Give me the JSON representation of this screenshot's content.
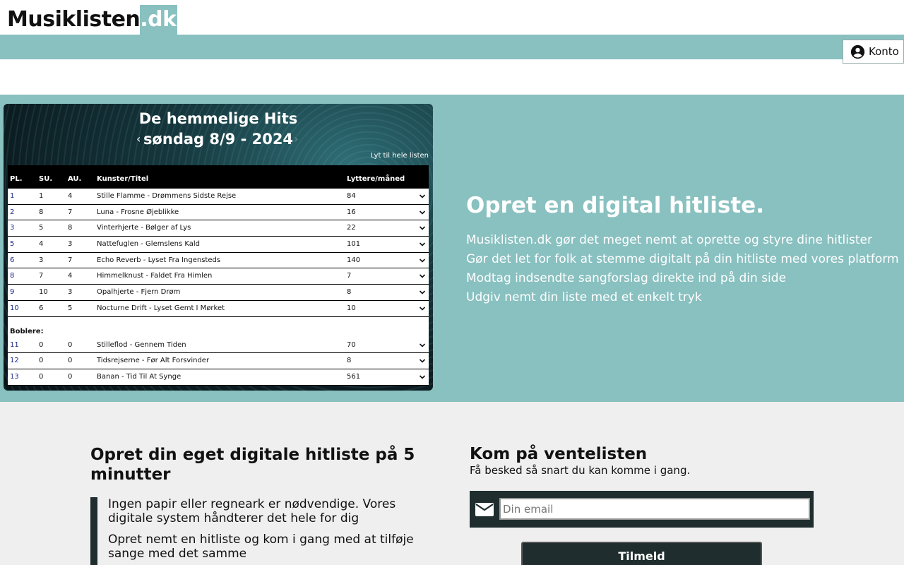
{
  "header": {
    "logo_main": "Musiklisten",
    "logo_tld": ".dk",
    "account_label": "Konto"
  },
  "chart": {
    "title": "De hemmelige Hits",
    "date": "søndag 8/9 - 2024",
    "listen_link": "Lyt til hele listen",
    "columns": {
      "pl": "PL.",
      "su": "SU.",
      "au": "AU.",
      "title": "Kunster/Titel",
      "listeners": "Lyttere/måned"
    },
    "rows": [
      {
        "pl": "1",
        "su": "1",
        "au": "4",
        "title": "Stille Flamme - Drømmens Sidste Rejse",
        "listeners": "84"
      },
      {
        "pl": "2",
        "su": "8",
        "au": "7",
        "title": "Luna - Frosne Øjeblikke",
        "listeners": "16"
      },
      {
        "pl": "3",
        "su": "5",
        "au": "8",
        "title": "Vinterhjerte - Bølger af Lys",
        "listeners": "22"
      },
      {
        "pl": "5",
        "su": "4",
        "au": "3",
        "title": "Nattefuglen - Glemslens Kald",
        "listeners": "101"
      },
      {
        "pl": "6",
        "su": "3",
        "au": "7",
        "title": "Echo Reverb - Lyset Fra Ingensteds",
        "listeners": "140"
      },
      {
        "pl": "8",
        "su": "7",
        "au": "4",
        "title": "Himmelknust - Faldet Fra Himlen",
        "listeners": "7"
      },
      {
        "pl": "9",
        "su": "10",
        "au": "3",
        "title": "Opalhjerte - Fjern Drøm",
        "listeners": "8"
      },
      {
        "pl": "10",
        "su": "6",
        "au": "5",
        "title": "Nocturne Drift - Lyset Gemt I Mørket",
        "listeners": "10"
      }
    ],
    "boblere_label": "Boblere:",
    "boblere": [
      {
        "pl": "11",
        "su": "0",
        "au": "0",
        "title": "Stilleflod - Gennem Tiden",
        "listeners": "70"
      },
      {
        "pl": "12",
        "su": "0",
        "au": "0",
        "title": "Tidsrejserne - Før Alt Forsvinder",
        "listeners": "8"
      },
      {
        "pl": "13",
        "su": "0",
        "au": "0",
        "title": "Banan - Tid Til At Synge",
        "listeners": "561"
      }
    ]
  },
  "hero": {
    "heading": "Opret en digital hitliste.",
    "lines": [
      "Musiklisten.dk gør det meget nemt at oprette og styre dine hitlister",
      "Gør det let for folk at stemme digitalt på din hitliste med vores platform",
      "Modtag indsendte sangforslag direkte ind på din side",
      "Udgiv nemt din liste med et enkelt tryk"
    ]
  },
  "features": {
    "heading": "Opret din eget digitale hitliste på 5 minutter",
    "items": [
      "Ingen papir eller regneark er nødvendige. Vores digitale system håndterer det hele for dig",
      "Opret nemt en hitliste og kom i gang med at tilføje sange med det samme"
    ]
  },
  "waitlist": {
    "heading": "Kom på ventelisten",
    "subheading": "Få besked så snart du kan komme i gang.",
    "email_placeholder": "Din email",
    "email_value": "",
    "submit_label": "Tilmeld"
  }
}
